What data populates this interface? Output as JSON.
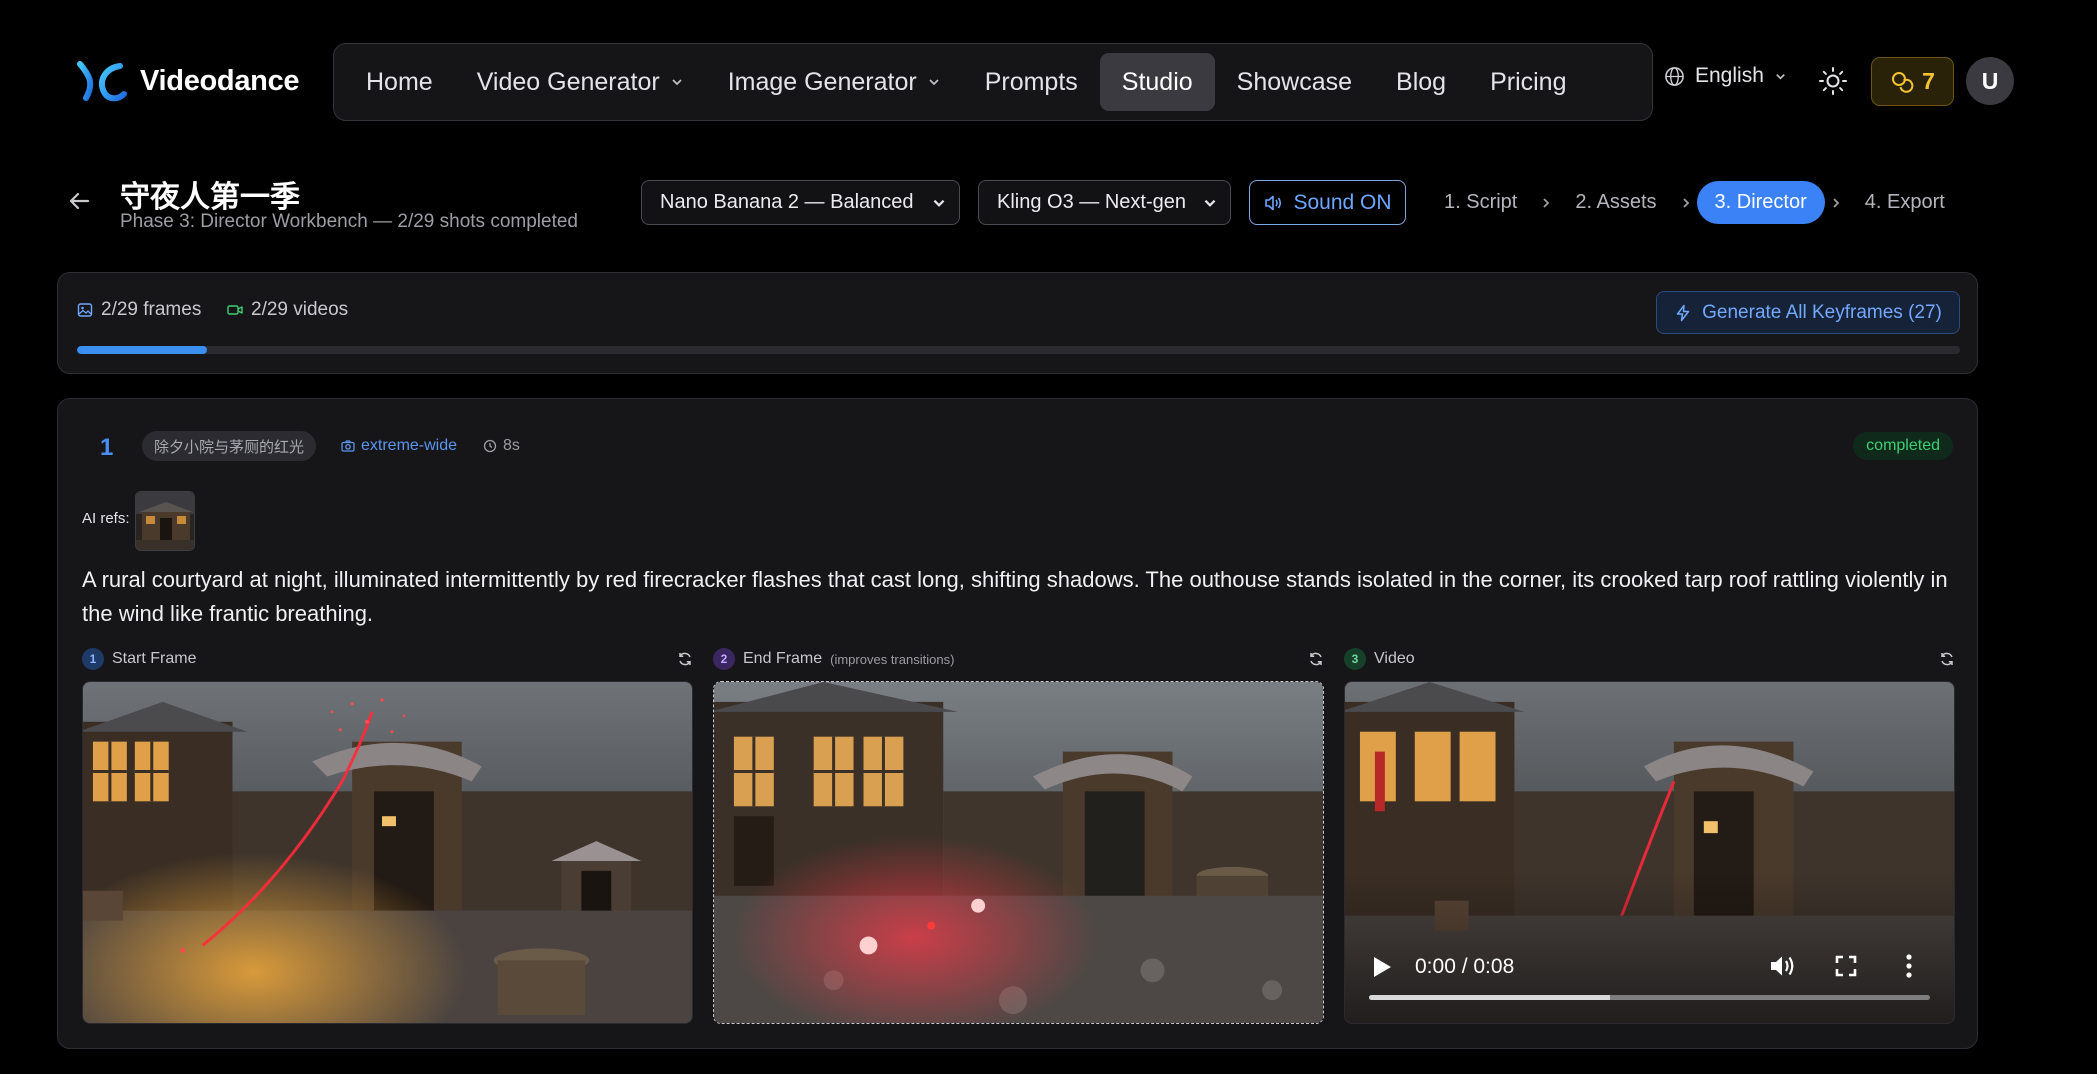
{
  "brand": {
    "name": "Videodance"
  },
  "nav": {
    "items": [
      {
        "label": "Home",
        "dropdown": false,
        "active": false
      },
      {
        "label": "Video Generator",
        "dropdown": true,
        "active": false
      },
      {
        "label": "Image Generator",
        "dropdown": true,
        "active": false
      },
      {
        "label": "Prompts",
        "dropdown": false,
        "active": false
      },
      {
        "label": "Studio",
        "dropdown": false,
        "active": true
      },
      {
        "label": "Showcase",
        "dropdown": false,
        "active": false
      },
      {
        "label": "Blog",
        "dropdown": false,
        "active": false
      },
      {
        "label": "Pricing",
        "dropdown": false,
        "active": false
      }
    ],
    "language": "English",
    "credits": "7",
    "avatar_initial": "U"
  },
  "project": {
    "title": "守夜人第一季",
    "subtitle": "Phase 3: Director Workbench — 2/29 shots completed"
  },
  "controls": {
    "image_model": "Nano Banana 2 — Balanced",
    "video_model": "Kling O3 — Next-gen",
    "sound_label": "Sound ON"
  },
  "steps": [
    {
      "label": "1. Script",
      "active": false
    },
    {
      "label": "2. Assets",
      "active": false
    },
    {
      "label": "3. Director",
      "active": true
    },
    {
      "label": "4. Export",
      "active": false
    }
  ],
  "progress": {
    "frames_label": "2/29 frames",
    "videos_label": "2/29 videos",
    "fraction": 0.069,
    "generate_all_label": "Generate All Keyframes (27)"
  },
  "shot": {
    "number": "1",
    "scene": "除夕小院与茅厕的红光",
    "shot_type": "extreme-wide",
    "duration": "8s",
    "status": "completed",
    "refs_label": "AI refs:",
    "description": "A rural courtyard at night, illuminated intermittently by red firecracker flashes that cast long, shifting shadows. The outhouse stands isolated in the corner, its crooked tarp roof rattling violently in the wind like frantic breathing.",
    "columns": {
      "start": {
        "badge": "1",
        "label": "Start Frame"
      },
      "end": {
        "badge": "2",
        "label": "End Frame",
        "note": "(improves transitions)"
      },
      "video": {
        "badge": "3",
        "label": "Video"
      }
    },
    "video": {
      "time": "0:00 / 0:08",
      "buffered_fraction": 0.43
    }
  },
  "colors": {
    "accent": "#3b82f6",
    "success": "#3ecf74",
    "credits": "#f2c431",
    "firecracker": "#ff2a3a"
  }
}
